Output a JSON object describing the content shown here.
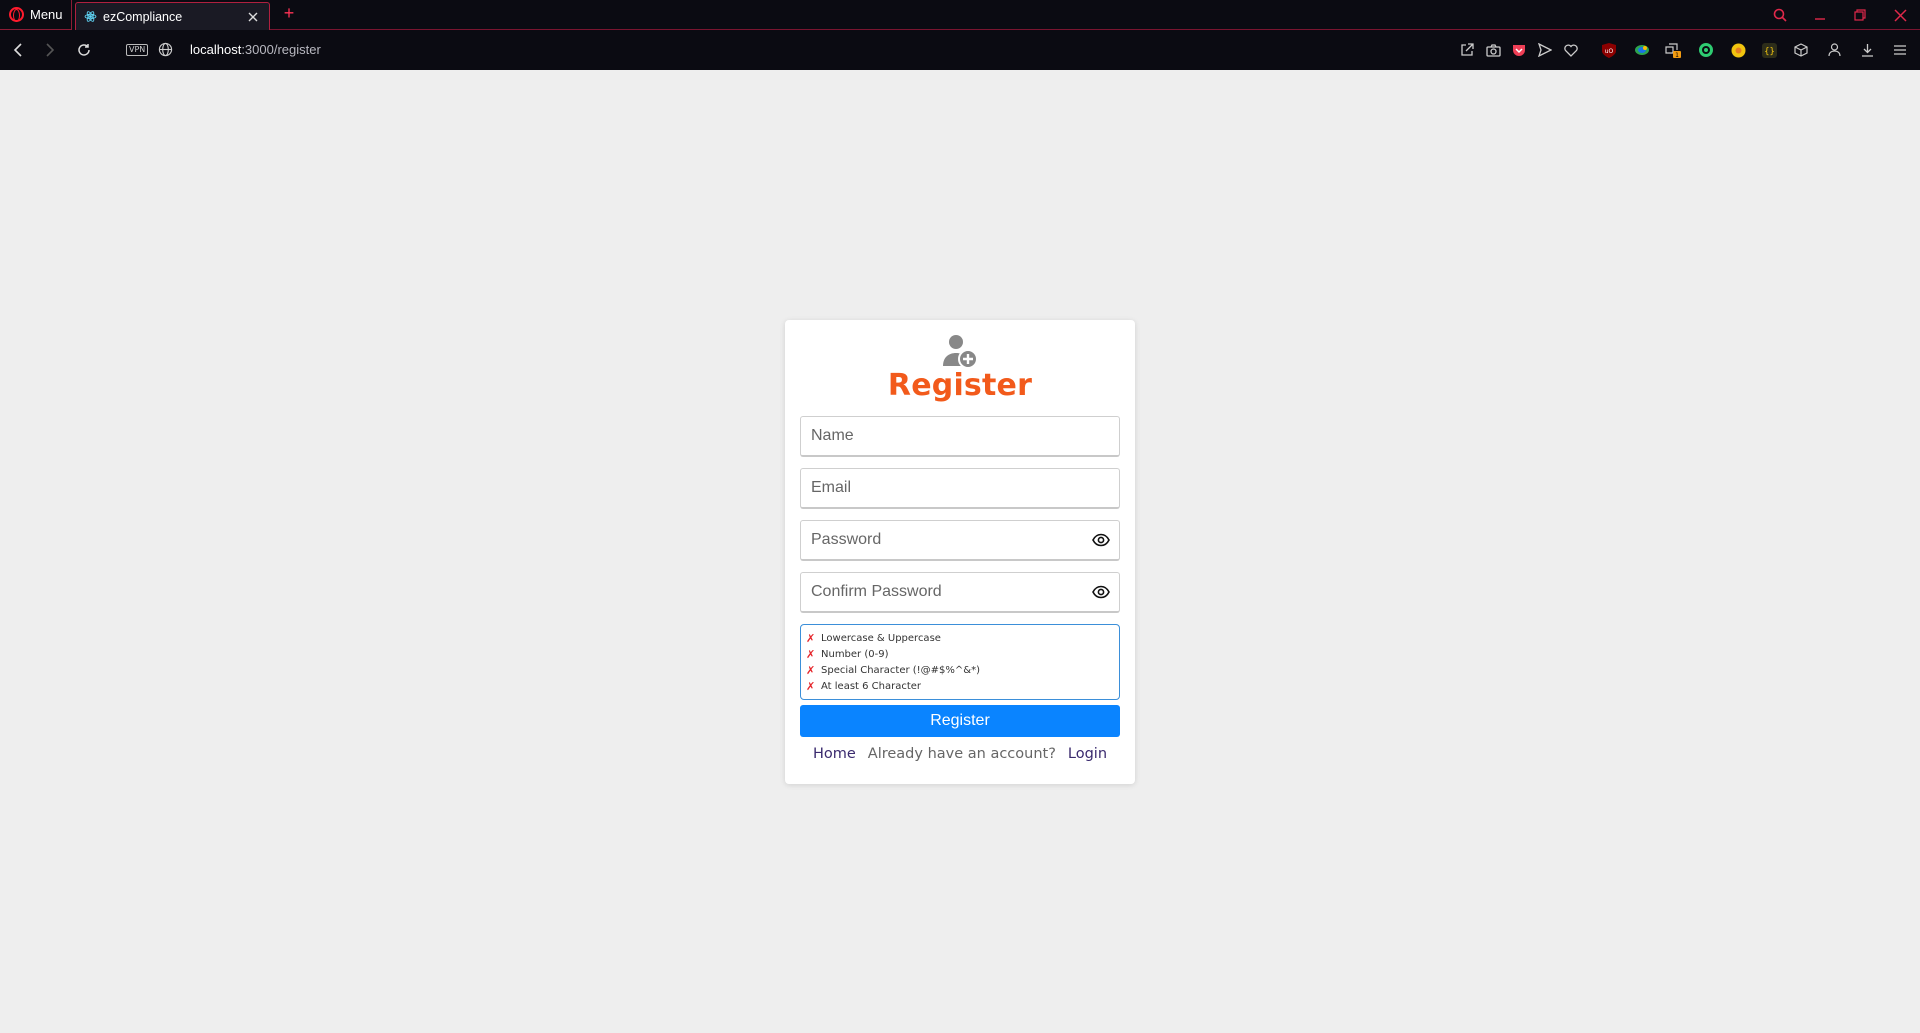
{
  "browser": {
    "menu_label": "Menu",
    "tab_title": "ezCompliance",
    "new_tab_symbol": "+",
    "url_host": "localhost",
    "url_path": ":3000/register",
    "vpn_label": "VPN"
  },
  "colors": {
    "accent": "#f25a1b",
    "primary_button": "#0a84ff",
    "browser_chrome": "#0b0b12",
    "opera_red": "#ff1b2d",
    "error": "#e5252a"
  },
  "form": {
    "title": "Register",
    "name_placeholder": "Name",
    "email_placeholder": "Email",
    "password_placeholder": "Password",
    "confirm_placeholder": "Confirm Password",
    "submit_label": "Register"
  },
  "password_rules": [
    "Lowercase & Uppercase",
    "Number (0-9)",
    "Special Character (!@#$%^&*)",
    "At least 6 Character"
  ],
  "footer": {
    "home": "Home",
    "prompt": "Already have an account?",
    "login": "Login"
  }
}
